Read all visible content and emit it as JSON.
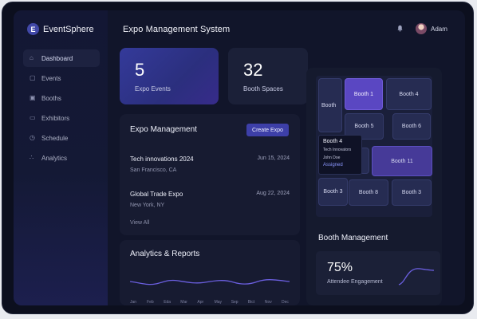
{
  "brand": {
    "logo_letter": "E",
    "name": "EventSphere"
  },
  "sidebar": {
    "items": [
      {
        "label": "Dashboard",
        "icon": "home-icon",
        "glyph": "⌂",
        "active": true
      },
      {
        "label": "Events",
        "icon": "calendar-icon",
        "glyph": "▢",
        "active": false
      },
      {
        "label": "Booths",
        "icon": "booth-icon",
        "glyph": "▣",
        "active": false
      },
      {
        "label": "Exhibitors",
        "icon": "briefcase-icon",
        "glyph": "▭",
        "active": false
      },
      {
        "label": "Schedule",
        "icon": "clock-icon",
        "glyph": "◷",
        "active": false
      },
      {
        "label": "Analytics",
        "icon": "analytics-icon",
        "glyph": "∴",
        "active": false
      }
    ]
  },
  "header": {
    "title": "Expo Management System",
    "user_name": "Adam",
    "bell_icon": "bell-icon"
  },
  "stats": [
    {
      "value": "5",
      "label": "Expo Events"
    },
    {
      "value": "32",
      "label": "Booth Spaces"
    }
  ],
  "expo_panel": {
    "title": "Expo Management",
    "create_label": "Create Expo",
    "events": [
      {
        "name": "Tech innovations 2024",
        "location": "San Francisco, CA",
        "date": "Jun 15, 2024"
      },
      {
        "name": "Global Trade Expo",
        "location": "New York, NY",
        "date": "Aug 22, 2024"
      }
    ],
    "view_all": "View All"
  },
  "analytics": {
    "title": "Analytics & Reports",
    "months": [
      "Jan",
      "Feb",
      "Eda",
      "Mar",
      "Apr",
      "May",
      "Sep",
      "Bict",
      "Nov",
      "Dec"
    ]
  },
  "booth_map": {
    "booths": [
      "Booth",
      "Booth 1",
      "Booth 4",
      "Booth 5",
      "Booth 6",
      "Booth 11",
      "Booth 3",
      "Booth 8",
      "Booth 3"
    ],
    "tooltip": {
      "title": "Booth 4",
      "company": "Tech Innovators",
      "person": "John Doe",
      "status": "Assigned"
    }
  },
  "booth_management": {
    "title": "Booth Management",
    "engagement_value": "75%",
    "engagement_label": "Attendee Engagement"
  },
  "colors": {
    "accent": "#3d3fa8",
    "booth_highlight": "#5a47c2",
    "chart_line": "#6b5fe0"
  }
}
